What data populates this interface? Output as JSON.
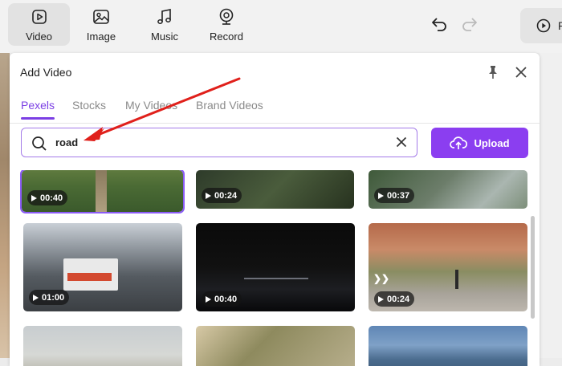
{
  "toolbar": {
    "items": [
      {
        "label": "Video",
        "icon": "video-icon"
      },
      {
        "label": "Image",
        "icon": "image-icon"
      },
      {
        "label": "Music",
        "icon": "music-note-icon"
      },
      {
        "label": "Record",
        "icon": "webcam-icon"
      }
    ],
    "preview_label": "P"
  },
  "panel": {
    "title": "Add Video",
    "tabs": [
      "Pexels",
      "Stocks",
      "My Videos",
      "Brand Videos"
    ],
    "search": {
      "value": "road",
      "placeholder": ""
    },
    "upload_label": "Upload"
  },
  "videos": [
    {
      "duration": "00:40"
    },
    {
      "duration": "00:24"
    },
    {
      "duration": "00:37"
    },
    {
      "duration": "01:00"
    },
    {
      "duration": "00:40"
    },
    {
      "duration": "00:24"
    },
    {
      "duration": ""
    },
    {
      "duration": ""
    },
    {
      "duration": ""
    }
  ],
  "colors": {
    "accent": "#8b3ef0",
    "tab_active": "#7b3fe4",
    "annotation_arrow": "#e0201b"
  }
}
